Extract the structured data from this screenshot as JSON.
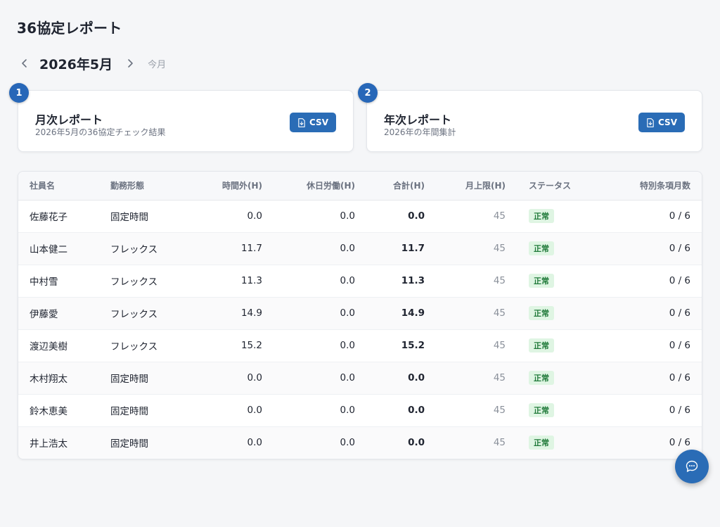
{
  "page": {
    "title": "36協定レポート"
  },
  "month_nav": {
    "prev_icon": "chevron-left-icon",
    "current": "2026年5月",
    "next_icon": "chevron-right-icon",
    "today_label": "今月"
  },
  "cards": [
    {
      "step": "1",
      "title": "月次レポート",
      "subtitle": "2026年5月の36協定チェック結果",
      "button_label": "CSV",
      "button_icon": "file-download-icon"
    },
    {
      "step": "2",
      "title": "年次レポート",
      "subtitle": "2026年の年間集計",
      "button_label": "CSV",
      "button_icon": "file-download-icon"
    }
  ],
  "table": {
    "headers": [
      "社員名",
      "勤務形態",
      "時間外(H)",
      "休日労働(H)",
      "合計(H)",
      "月上限(H)",
      "ステータス",
      "特別条項月数"
    ],
    "rows": [
      {
        "name": "佐藤花子",
        "type": "固定時間",
        "overtime": "0.0",
        "holiday": "0.0",
        "total": "0.0",
        "limit": "45",
        "status": "正常",
        "special": "0 / 6"
      },
      {
        "name": "山本健二",
        "type": "フレックス",
        "overtime": "11.7",
        "holiday": "0.0",
        "total": "11.7",
        "limit": "45",
        "status": "正常",
        "special": "0 / 6"
      },
      {
        "name": "中村雪",
        "type": "フレックス",
        "overtime": "11.3",
        "holiday": "0.0",
        "total": "11.3",
        "limit": "45",
        "status": "正常",
        "special": "0 / 6"
      },
      {
        "name": "伊藤愛",
        "type": "フレックス",
        "overtime": "14.9",
        "holiday": "0.0",
        "total": "14.9",
        "limit": "45",
        "status": "正常",
        "special": "0 / 6"
      },
      {
        "name": "渡辺美樹",
        "type": "フレックス",
        "overtime": "15.2",
        "holiday": "0.0",
        "total": "15.2",
        "limit": "45",
        "status": "正常",
        "special": "0 / 6"
      },
      {
        "name": "木村翔太",
        "type": "固定時間",
        "overtime": "0.0",
        "holiday": "0.0",
        "total": "0.0",
        "limit": "45",
        "status": "正常",
        "special": "0 / 6"
      },
      {
        "name": "鈴木恵美",
        "type": "固定時間",
        "overtime": "0.0",
        "holiday": "0.0",
        "total": "0.0",
        "limit": "45",
        "status": "正常",
        "special": "0 / 6"
      },
      {
        "name": "井上浩太",
        "type": "固定時間",
        "overtime": "0.0",
        "holiday": "0.0",
        "total": "0.0",
        "limit": "45",
        "status": "正常",
        "special": "0 / 6"
      }
    ]
  },
  "chat_button": {
    "icon": "chat-bubble-icon"
  },
  "colors": {
    "accent": "#2a6cb6",
    "status_ok_bg": "#dff5e3",
    "status_ok_text": "#207a3a",
    "background": "#f5f6f8"
  }
}
